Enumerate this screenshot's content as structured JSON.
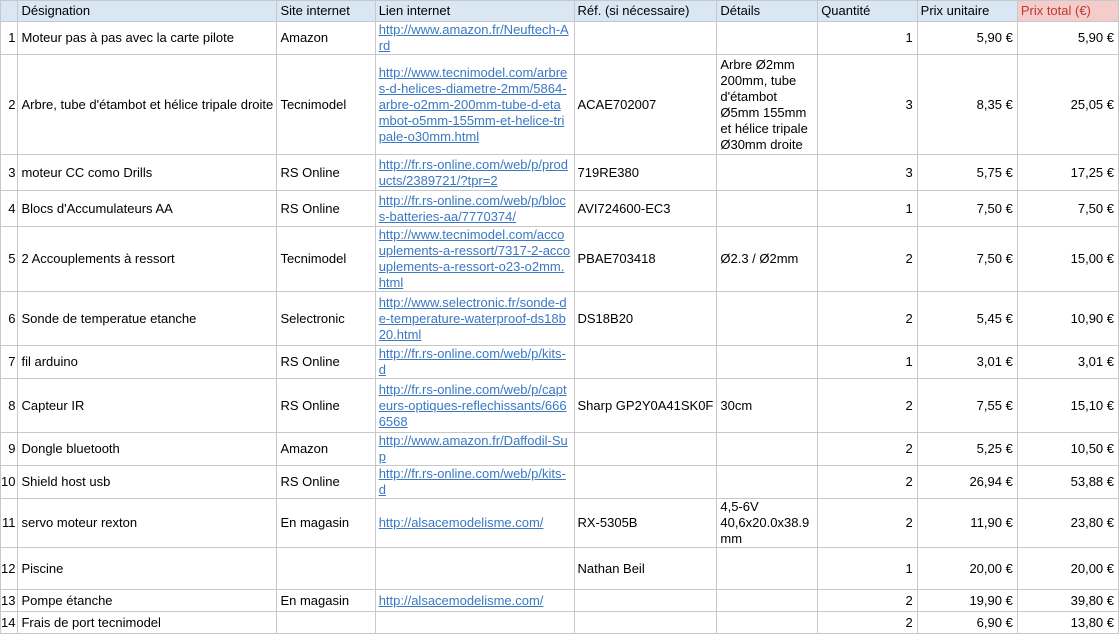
{
  "headers": [
    "Désignation",
    "Site internet",
    "Lien internet",
    "Réf. (si nécessaire)",
    "Détails",
    "Quantité",
    "Prix unitaire",
    "Prix total (€)"
  ],
  "accent": {
    "header_bg": "#d9e7f5",
    "total_header_bg": "#f4cccc",
    "total_header_text": "#c0392b",
    "link": "#3a78c3"
  },
  "rows": [
    {
      "n": "1",
      "designation": "Moteur pas à pas avec la carte pilote",
      "site": "Amazon",
      "link": "http://www.amazon.fr/Neuftech-Ard",
      "ref": "",
      "details": "",
      "qty": "1",
      "unit": "5,90 €",
      "total": "5,90 €"
    },
    {
      "n": "2",
      "designation": "Arbre, tube d'étambot et hélice tripale droite",
      "site": "Tecnimodel",
      "link": "http://www.tecnimodel.com/arbres-d-helices-diametre-2mm/5864-arbre-o2mm-200mm-tube-d-etambot-o5mm-155mm-et-helice-tripale-o30mm.html",
      "ref": "ACAE702007",
      "details": "Arbre Ø2mm 200mm, tube d'étambot Ø5mm 155mm et hélice tripale Ø30mm droite",
      "qty": "3",
      "unit": "8,35 €",
      "total": "25,05 €"
    },
    {
      "n": "3",
      "designation": "moteur CC como Drills",
      "site": "RS Online",
      "link": "http://fr.rs-online.com/web/p/products/2389721/?tpr=2",
      "ref": "719RE380",
      "details": "",
      "qty": "3",
      "unit": "5,75 €",
      "total": "17,25 €"
    },
    {
      "n": "4",
      "designation": "Blocs d'Accumulateurs AA",
      "site": "RS Online",
      "link": "http://fr.rs-online.com/web/p/blocs-batteries-aa/7770374/",
      "ref": "AVI724600-EC3",
      "details": "",
      "qty": "1",
      "unit": "7,50 €",
      "total": "7,50 €"
    },
    {
      "n": "5",
      "designation": "2 Accouplements à ressort",
      "site": "Tecnimodel",
      "link": "http://www.tecnimodel.com/accouplements-a-ressort/7317-2-accouplements-a-ressort-o23-o2mm.html",
      "ref": "PBAE703418",
      "details": "Ø2.3 / Ø2mm",
      "qty": "2",
      "unit": "7,50 €",
      "total": "15,00 €"
    },
    {
      "n": "6",
      "designation": "Sonde de temperatue etanche",
      "site": "Selectronic",
      "link": "http://www.selectronic.fr/sonde-de-temperature-waterproof-ds18b20.html",
      "ref": " DS18B20",
      "details": "",
      "qty": "2",
      "unit": "5,45 €",
      "total": "10,90 €"
    },
    {
      "n": "7",
      "designation": "fil arduino",
      "site": "RS Online",
      "link": "http://fr.rs-online.com/web/p/kits-d",
      "ref": "",
      "details": "",
      "qty": "1",
      "unit": "3,01 €",
      "total": "3,01 €"
    },
    {
      "n": "8",
      "designation": "Capteur IR",
      "site": "RS Online",
      "link": "http://fr.rs-online.com/web/p/capteurs-optiques-reflechissants/6666568",
      "ref": "Sharp GP2Y0A41SK0F",
      "details": "30cm",
      "qty": "2",
      "unit": "7,55 €",
      "total": "15,10 €"
    },
    {
      "n": "9",
      "designation": "Dongle bluetooth",
      "site": "Amazon",
      "link": "http://www.amazon.fr/Daffodil-Sup",
      "ref": "",
      "details": "",
      "qty": "2",
      "unit": "5,25 €",
      "total": "10,50 €"
    },
    {
      "n": "10",
      "designation": "Shield host usb",
      "site": "RS Online",
      "link": "http://fr.rs-online.com/web/p/kits-d",
      "ref": "",
      "details": "",
      "qty": "2",
      "unit": "26,94 €",
      "total": "53,88 €"
    },
    {
      "n": "11",
      "designation": "servo moteur rexton",
      "site": "En magasin",
      "link": "http://alsacemodelisme.com/",
      "ref": "RX-5305B",
      "details": "4,5-6V 40,6x20.0x38.9 mm",
      "qty": "2",
      "unit": "11,90 €",
      "total": "23,80 €"
    },
    {
      "n": "12",
      "designation": "Piscine",
      "site": "",
      "link": "",
      "ref": "Nathan Beil",
      "details": "",
      "qty": "1",
      "unit": "20,00 €",
      "total": "20,00 €"
    },
    {
      "n": "13",
      "designation": "Pompe étanche",
      "site": "En magasin",
      "link": "http://alsacemodelisme.com/",
      "ref": "",
      "details": "",
      "qty": "2",
      "unit": "19,90 €",
      "total": "39,80 €"
    },
    {
      "n": "14",
      "designation": "Frais de port tecnimodel",
      "site": "",
      "link": "",
      "ref": "",
      "details": "",
      "qty": "2",
      "unit": "6,90 €",
      "total": "13,80 €"
    }
  ]
}
